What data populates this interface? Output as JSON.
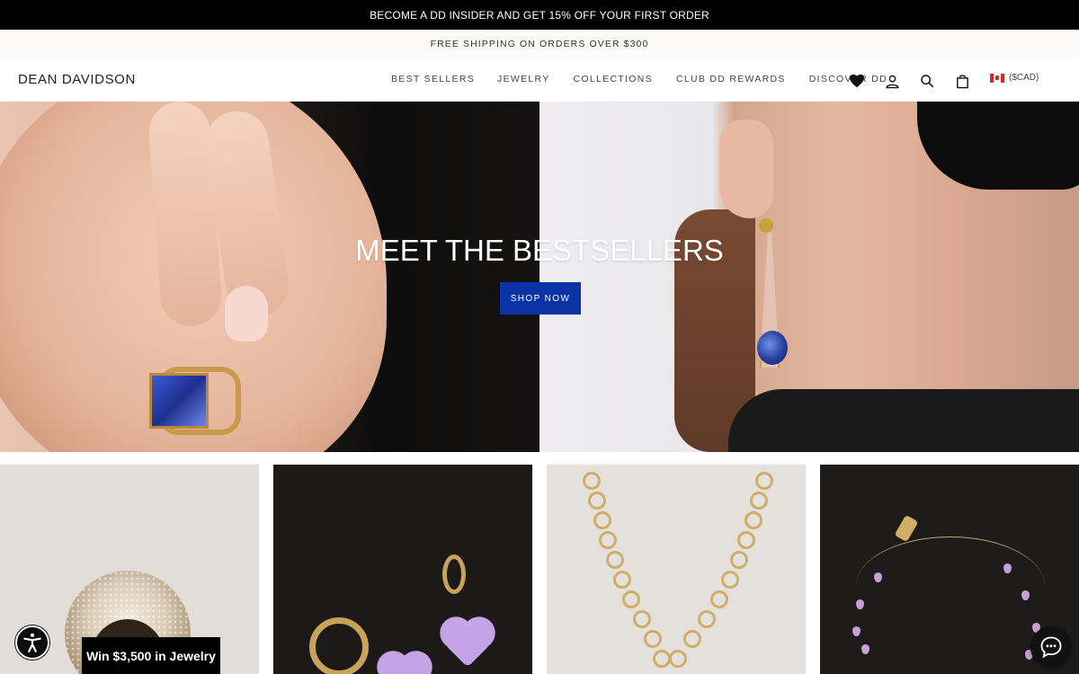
{
  "promo": {
    "text": "BECOME A DD INSIDER AND GET 15% OFF YOUR FIRST ORDER"
  },
  "shipping": {
    "text": "FREE SHIPPING ON ORDERS OVER $300"
  },
  "header": {
    "logo": "DEAN DAVIDSON",
    "nav": [
      "BEST SELLERS",
      "JEWELRY",
      "COLLECTIONS",
      "CLUB DD REWARDS",
      "DISCOVER DD"
    ],
    "icons": [
      "heart-icon",
      "user-icon",
      "search-icon",
      "bag-icon"
    ],
    "currency": "($CAD)"
  },
  "hero": {
    "title": "MEET THE BESTSELLERS",
    "cta": "SHOP NOW",
    "cta_color": "#0a34a6"
  },
  "tiles": [
    "pave-ring",
    "heart-earrings",
    "gold-chain-necklace",
    "charm-bracelet"
  ],
  "widgets": {
    "promo_badge": "Win $3,500 in Jewelry",
    "accessibility_icon": "accessibility-icon",
    "chat_icon": "chat-icon"
  }
}
